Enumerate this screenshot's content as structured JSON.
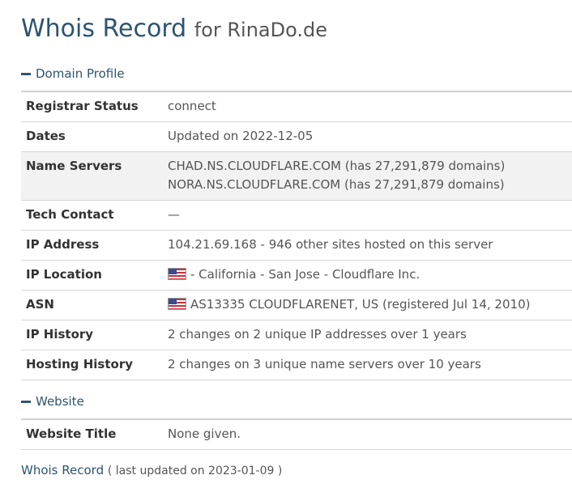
{
  "header": {
    "title": "Whois Record",
    "subtitle": "for RinaDo.de"
  },
  "domain_profile": {
    "section_title": "Domain Profile",
    "rows": {
      "registrar_status": {
        "label": "Registrar Status",
        "value": "connect"
      },
      "dates": {
        "label": "Dates",
        "value": "Updated on 2022-12-05"
      },
      "name_servers": {
        "label": "Name Servers",
        "values": [
          "CHAD.NS.CLOUDFLARE.COM (has 27,291,879 domains)",
          "NORA.NS.CLOUDFLARE.COM (has 27,291,879 domains)"
        ]
      },
      "tech_contact": {
        "label": "Tech Contact",
        "value": "—"
      },
      "ip_address": {
        "label": "IP Address",
        "value": "104.21.69.168 - 946 other sites hosted on this server"
      },
      "ip_location": {
        "label": "IP Location",
        "flag_icon": "us-flag-icon",
        "value": "- California - San Jose - Cloudflare Inc."
      },
      "asn": {
        "label": "ASN",
        "flag_icon": "us-flag-icon",
        "value": "AS13335 CLOUDFLARENET, US (registered Jul 14, 2010)"
      },
      "ip_history": {
        "label": "IP History",
        "value": "2 changes on 2 unique IP addresses over 1 years"
      },
      "hosting_history": {
        "label": "Hosting History",
        "value": "2 changes on 3 unique name servers over 10 years"
      }
    }
  },
  "website": {
    "section_title": "Website",
    "rows": {
      "website_title": {
        "label": "Website Title",
        "value": "None given."
      }
    }
  },
  "footer": {
    "link_text": "Whois Record",
    "meta_text": "( last updated on 2023-01-09 )"
  },
  "colors": {
    "accent": "#2d5472",
    "row_shade": "#f2f2f2",
    "divider": "#d6d6d6"
  }
}
